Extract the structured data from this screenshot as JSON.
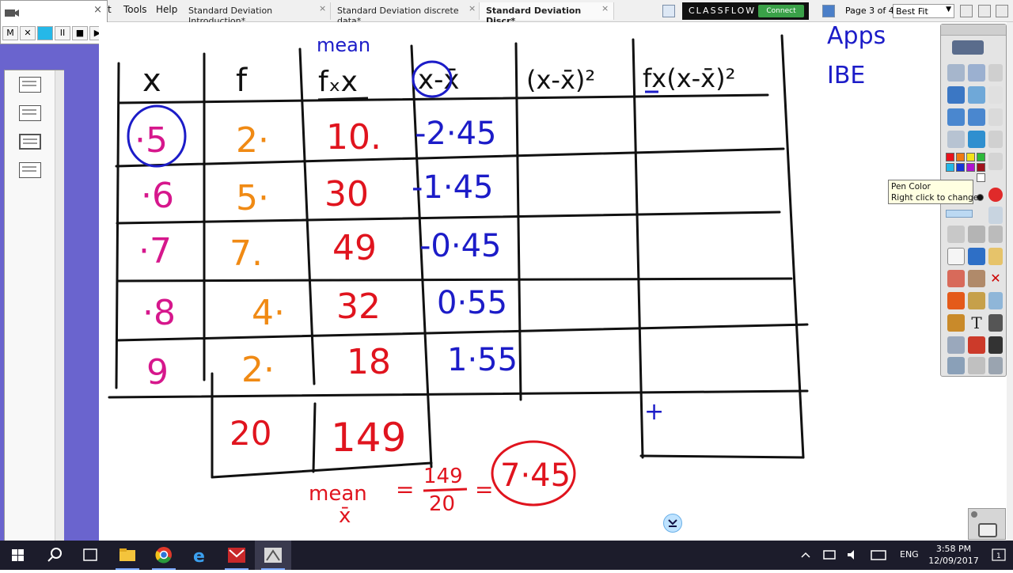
{
  "menu": {
    "item_t": "t",
    "tools": "Tools",
    "help": "Help"
  },
  "tabs": [
    {
      "label": "Standard Deviation Introduction*"
    },
    {
      "label": "Standard Deviation discrete data*"
    },
    {
      "label": "Standard Deviation Discr*"
    }
  ],
  "tab_close": "×",
  "classflow": {
    "logo": "CLASSFLOW",
    "connect": "Connect"
  },
  "page_indicator": "Page 3 of 4",
  "zoom_select": "Best Fit",
  "recorder": {
    "buttons": [
      "M",
      "✕",
      "",
      "II",
      "■",
      "▶"
    ],
    "close": "×"
  },
  "tooltip": {
    "line1": "Pen Color",
    "line2": "Right click to change"
  },
  "board": {
    "header_mean": "mean",
    "headers": [
      "x",
      "f",
      "fₓx",
      "x-x̄",
      "(x-x̄)²",
      "fx(x-x̄)²"
    ],
    "side_notes": [
      "Apps",
      "IBE"
    ],
    "rows": [
      {
        "x": "·5",
        "f": "2·",
        "fx": "10.",
        "dev": "-2·45"
      },
      {
        "x": "·6",
        "f": "5·",
        "fx": "30",
        "dev": "-1·45"
      },
      {
        "x": "·7",
        "f": "7.",
        "fx": "49",
        "dev": "-0·45"
      },
      {
        "x": "·8",
        "f": "4·",
        "fx": "32",
        "dev": "0·55"
      },
      {
        "x": "9",
        "f": "2·",
        "fx": "18",
        "dev": "1·55"
      }
    ],
    "totals": {
      "f": "20",
      "fx": "149",
      "last": "+"
    },
    "formula": {
      "lhs": "mean",
      "lhs2": "x̄",
      "eq1": "=",
      "num": "149",
      "den": "20",
      "eq2": "=",
      "result": "7·45"
    }
  },
  "colors": {
    "pink": "#d6178c",
    "orange": "#f08a14",
    "red": "#e0141e",
    "blue": "#1c1cc8",
    "sidebar": "#6a64ce"
  },
  "taskbar": {
    "icons": [
      "windows-start-icon",
      "search-icon",
      "task-view-icon",
      "file-explorer-icon",
      "chrome-icon",
      "ie-icon",
      "mail-app-icon",
      "activinspire-icon"
    ],
    "tray": [
      "chevron-up-icon",
      "network-icon",
      "volume-icon",
      "keyboard-icon"
    ],
    "language": "ENG",
    "time": "3:58 PM",
    "date": "12/09/2017"
  }
}
